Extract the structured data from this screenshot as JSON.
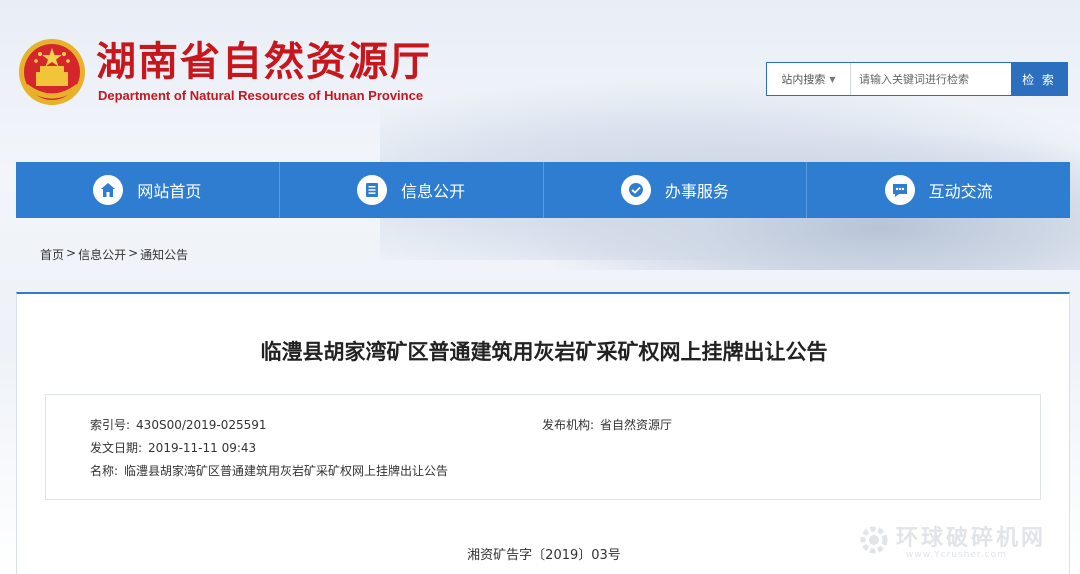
{
  "header": {
    "title": "湖南省自然资源厅",
    "subtitle": "Department of Natural Resources of Hunan Province"
  },
  "search": {
    "scope_label": "站内搜索",
    "placeholder": "请输入关键词进行检索",
    "button_label": "检 索"
  },
  "nav": {
    "items": [
      {
        "label": "网站首页",
        "icon": "home-icon"
      },
      {
        "label": "信息公开",
        "icon": "document-list-icon"
      },
      {
        "label": "办事服务",
        "icon": "handshake-icon"
      },
      {
        "label": "互动交流",
        "icon": "chat-bubble-icon"
      }
    ]
  },
  "breadcrumb": {
    "items": [
      "首页",
      "信息公开",
      "通知公告"
    ],
    "separator": ">"
  },
  "article": {
    "title": "临澧县胡家湾矿区普通建筑用灰岩矿采矿权网上挂牌出让公告",
    "index_label": "索引号:",
    "index_value": "430S00/2019-025591",
    "publisher_label": "发布机构:",
    "publisher_value": "省自然资源厅",
    "date_label": "发文日期:",
    "date_value": "2019-11-11 09:43",
    "name_label": "名称:",
    "name_value": "临澧县胡家湾矿区普通建筑用灰岩矿采矿权网上挂牌出让公告",
    "doc_number": "湘资矿告字〔2019〕03号"
  },
  "watermark": {
    "text": "环球破碎机网",
    "url": "www.Ycrusher.com"
  },
  "colors": {
    "brand_red": "#c8161d",
    "nav_blue": "#2f7dd1",
    "search_blue": "#2b6fbe"
  }
}
